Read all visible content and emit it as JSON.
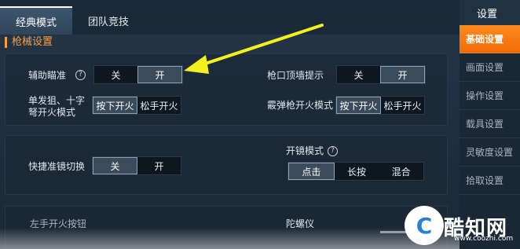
{
  "tabs": [
    {
      "label": "经典模式",
      "active": true
    },
    {
      "label": "团队竞技",
      "active": false
    }
  ],
  "section_title": "枪械设置",
  "settings": {
    "aim_assist": {
      "label": "辅助瞄准",
      "help": "?",
      "options": [
        "关",
        "开"
      ],
      "selected": "开"
    },
    "muzzle_hint": {
      "label": "枪口顶墙提示",
      "options": [
        "关",
        "开"
      ],
      "selected": "开"
    },
    "single_fire": {
      "label_line1": "单发狙、十字",
      "label_line2": "弩开火模式",
      "options": [
        "按下开火",
        "松手开火"
      ],
      "selected": "按下开火"
    },
    "shotgun_fire": {
      "label": "霰弹枪开火模式",
      "options": [
        "按下开火",
        "松手开火"
      ],
      "selected": "按下开火"
    },
    "quick_scope": {
      "label": "快捷准镜切换",
      "options": [
        "关",
        "开"
      ],
      "selected": "关"
    },
    "scope_mode": {
      "label": "开镜模式",
      "help": "?",
      "options": [
        "点击",
        "长按",
        "混合"
      ],
      "selected": "点击"
    },
    "left_fire": {
      "label": "左手开火按钮"
    },
    "gyro": {
      "label": "陀螺仪"
    }
  },
  "sidebar": {
    "header": "设置",
    "items": [
      {
        "label": "基础设置",
        "active": true
      },
      {
        "label": "画面设置",
        "active": false
      },
      {
        "label": "操作设置",
        "active": false
      },
      {
        "label": "载具设置",
        "active": false
      },
      {
        "label": "灵敏度设置",
        "active": false
      },
      {
        "label": "拾取设置",
        "active": false
      }
    ]
  },
  "watermark": {
    "name": "酷知网",
    "url": "www.coozhi.com",
    "logo": "C"
  },
  "colors": {
    "accent": "#ff8a1e",
    "section_title": "#ff9d3a",
    "arrow": "#f2f21a"
  }
}
